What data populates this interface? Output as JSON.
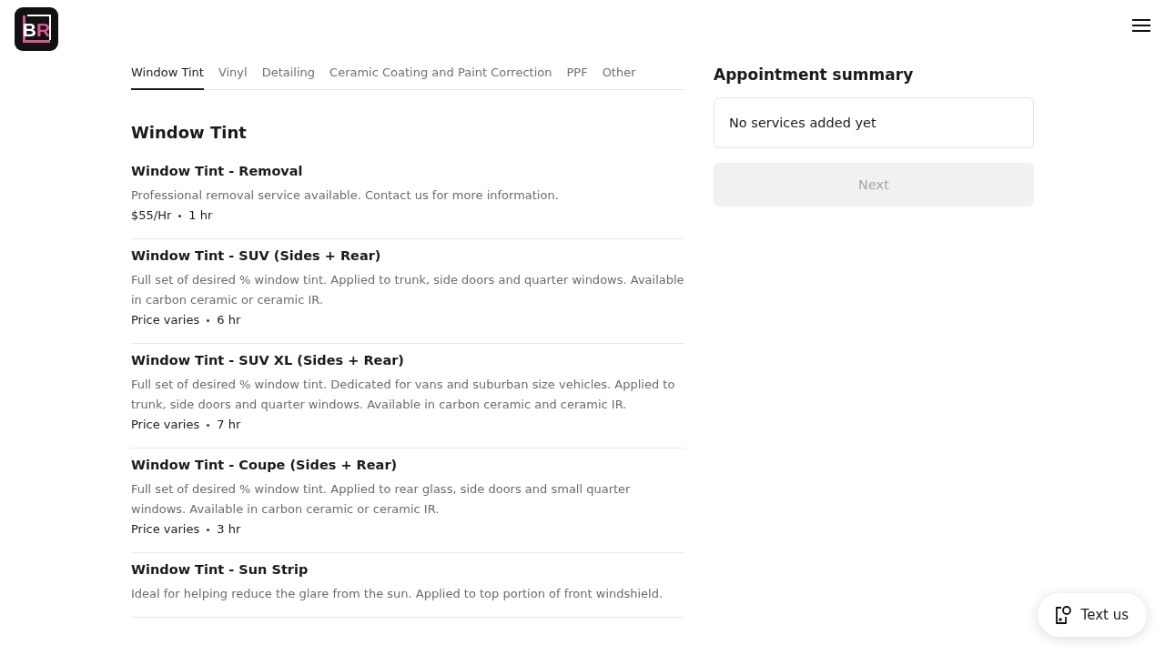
{
  "logo": {
    "letters": [
      "B",
      "R"
    ]
  },
  "tabs": [
    {
      "label": "Window Tint",
      "selected": true
    },
    {
      "label": "Vinyl",
      "selected": false
    },
    {
      "label": "Detailing",
      "selected": false
    },
    {
      "label": "Ceramic Coating and Paint Correction",
      "selected": false
    },
    {
      "label": "PPF",
      "selected": false
    },
    {
      "label": "Other",
      "selected": false
    }
  ],
  "section_title": "Window Tint",
  "services": [
    {
      "name": "Window Tint - Removal",
      "description": "Professional removal service available. Contact us for more information.",
      "price": "$55/Hr",
      "duration": "1 hr"
    },
    {
      "name": "Window Tint - SUV (Sides + Rear)",
      "description": "Full set of desired % window tint. Applied to trunk, side doors and quarter windows. Available in carbon ceramic or ceramic IR.",
      "price": "Price varies",
      "duration": "6 hr"
    },
    {
      "name": "Window Tint - SUV XL (Sides + Rear)",
      "description": "Full set of desired % window tint. Dedicated for vans and suburban size vehicles. Applied to trunk, side doors and quarter windows. Available in carbon ceramic and ceramic IR.",
      "price": "Price varies",
      "duration": "7 hr"
    },
    {
      "name": "Window Tint - Coupe (Sides + Rear)",
      "description": "Full set of desired % window tint. Applied to rear glass, side doors and small quarter windows. Available in carbon ceramic or ceramic IR.",
      "price": "Price varies",
      "duration": "3 hr"
    },
    {
      "name": "Window Tint - Sun Strip",
      "description": "Ideal for helping reduce the glare from the sun. Applied to top portion of front windshield."
    }
  ],
  "summary": {
    "title": "Appointment summary",
    "empty_text": "No services added yet",
    "next_button": {
      "label": "Next",
      "disabled": true
    }
  },
  "text_us_button": "Text us"
}
